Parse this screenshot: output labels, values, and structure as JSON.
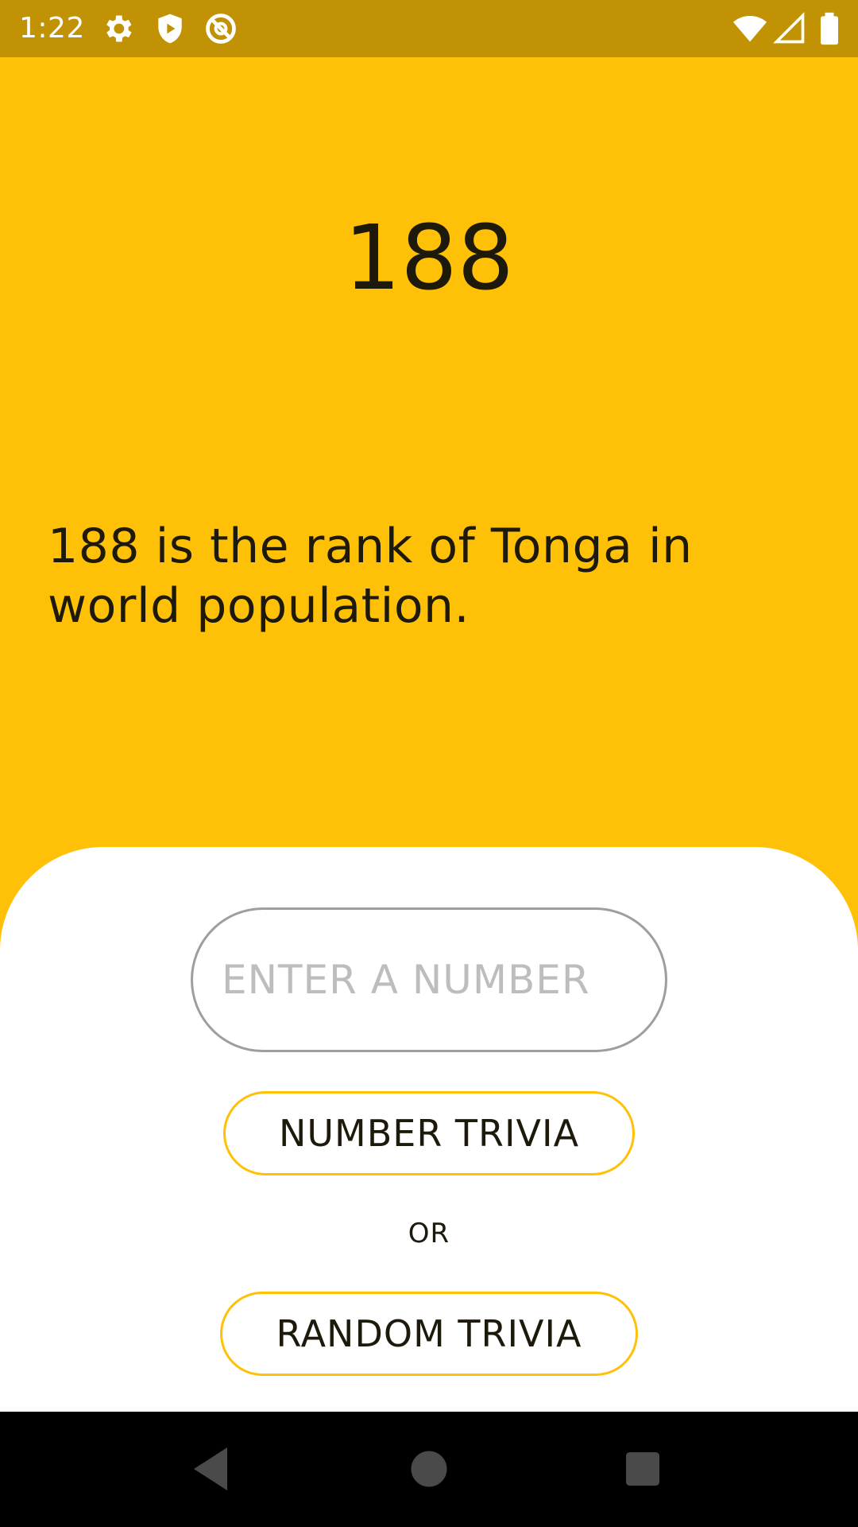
{
  "status_bar": {
    "time": "1:22",
    "icons": [
      "gear-icon",
      "play-protect-icon",
      "no-disturb-icon",
      "wifi-icon",
      "cell-signal-icon",
      "battery-icon"
    ]
  },
  "main": {
    "number": "188",
    "trivia": "188 is the rank of Tonga in world population."
  },
  "controls": {
    "input_placeholder": "ENTER A NUMBER",
    "number_trivia_label": "NUMBER TRIVIA",
    "or_label": "OR",
    "random_trivia_label": "RANDOM TRIVIA"
  },
  "nav": {
    "icons": [
      "back-icon",
      "home-icon",
      "recents-icon"
    ]
  },
  "colors": {
    "accent": "#FFC107",
    "status_bar": "#C09204",
    "text": "#1d1a0c"
  }
}
